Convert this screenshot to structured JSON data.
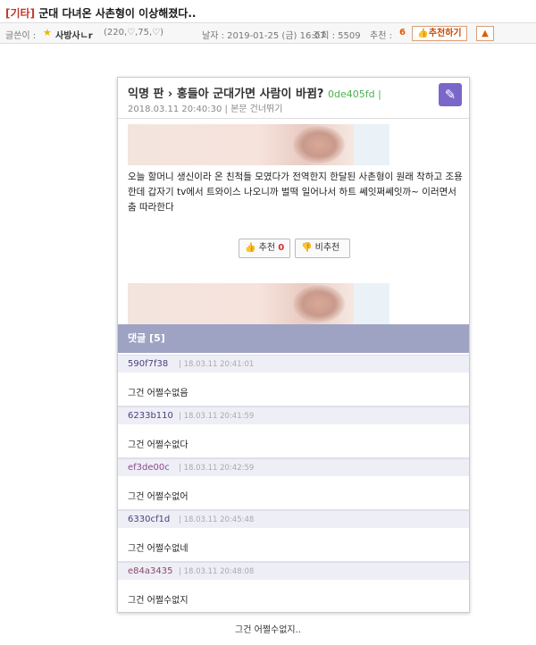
{
  "post": {
    "category": "[기타]",
    "title": "군대 다녀온 사촌형이 이상해졌다..",
    "author_label": "글쓴이 :",
    "author": "사방사ㄴr",
    "author_stats": "(220,♡,75,♡)",
    "date_label": "날자 : 2019-01-25 (금) 16:07",
    "views_label": "조회 : 5509",
    "recommend_label": "추천 :",
    "recommend_count": "6",
    "recommend_button": "추천하기",
    "caption": "그건 어쩔수없지.."
  },
  "screenshot": {
    "title": "익명 판 › 홍들아 군대가면 사람이 바뀜?",
    "uid": "0de405fd",
    "sub": "2018.03.11 20:40:30 | 본문 건너뛰기",
    "body": "오늘 할머니 생신이라 온 친척들 모였다가 전역한지 한달된 사촌형이 원래 착하고 조용한데 갑자기 tv에서 트와이스 나오니까 벌떡 일어나서 하트 쎄잇쩌쎄잇까~ 이러면서 춤 따라한다",
    "upvote_label": "추천",
    "upvote_count": "0",
    "downvote_label": "비추천",
    "comments_header": "댓글 [5]",
    "comments": [
      {
        "uid": "590f7f38",
        "time": "| 18.03.11 20:41:01",
        "text": "그건 어쩔수없음",
        "color": "#4a3f7a"
      },
      {
        "uid": "6233b110",
        "time": "| 18.03.11 20:41:59",
        "text": "그건 어쩔수없다",
        "color": "#4a3f7a"
      },
      {
        "uid": "ef3de00c",
        "time": "| 18.03.11 20:42:59",
        "text": "그건 어쩔수없어",
        "color": "#8a4a8a"
      },
      {
        "uid": "6330cf1d",
        "time": "| 18.03.11 20:45:48",
        "text": "그건 어쩔수없네",
        "color": "#4a3f7a"
      },
      {
        "uid": "e84a3435",
        "time": "| 18.03.11 20:48:08",
        "text": "그건 어쩔수없지",
        "color": "#8a4a6a"
      }
    ]
  },
  "colors": {
    "category": "#c0392b",
    "recommend": "#e05a00",
    "uid_green": "#4caf50",
    "pen_button": "#7b67c9",
    "comments_bar": "#9fa3c3"
  },
  "icons": [
    "medal-icon",
    "thumbs-up-icon",
    "thumbs-down-icon",
    "pencil-icon",
    "siren-icon"
  ]
}
